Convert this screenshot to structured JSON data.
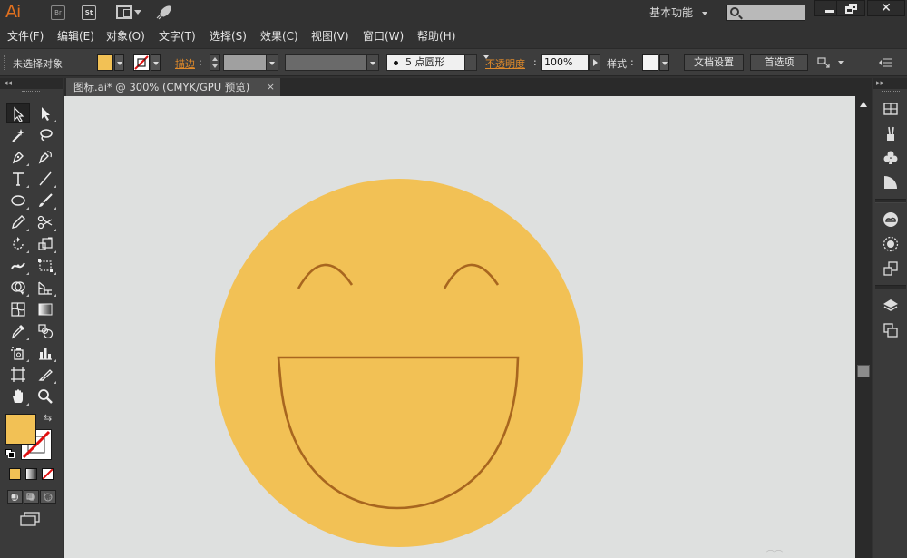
{
  "app": {
    "logo": "Ai",
    "bridge_icon_label": "Br",
    "stock_icon_label": "St",
    "workspace": "基本功能",
    "search_placeholder": ""
  },
  "menu": {
    "items": [
      "文件(F)",
      "编辑(E)",
      "对象(O)",
      "文字(T)",
      "选择(S)",
      "效果(C)",
      "视图(V)",
      "窗口(W)",
      "帮助(H)"
    ]
  },
  "control_bar": {
    "selection_status": "未选择对象",
    "fill_color": "#f2c155",
    "stroke_label": "描边",
    "stroke_colon": ":",
    "brush_label": "5 点圆形",
    "opacity_label": "不透明度",
    "opacity_colon": ":",
    "opacity_value": "100%",
    "style_label": "样式",
    "style_colon": ":",
    "doc_setup_button": "文档设置",
    "preferences_button": "首选项"
  },
  "document": {
    "tab_title": "图标.ai* @ 300% (CMYK/GPU 预览)",
    "tab_close": "×"
  },
  "artwork": {
    "face_color": "#f2c155",
    "line_color": "#a8661f",
    "canvas_bg": "#dee0df"
  },
  "tools": {
    "fill_color": "#f2c155",
    "stroke_color": "none"
  },
  "colors": {
    "accent_orange": "#e0701f"
  }
}
